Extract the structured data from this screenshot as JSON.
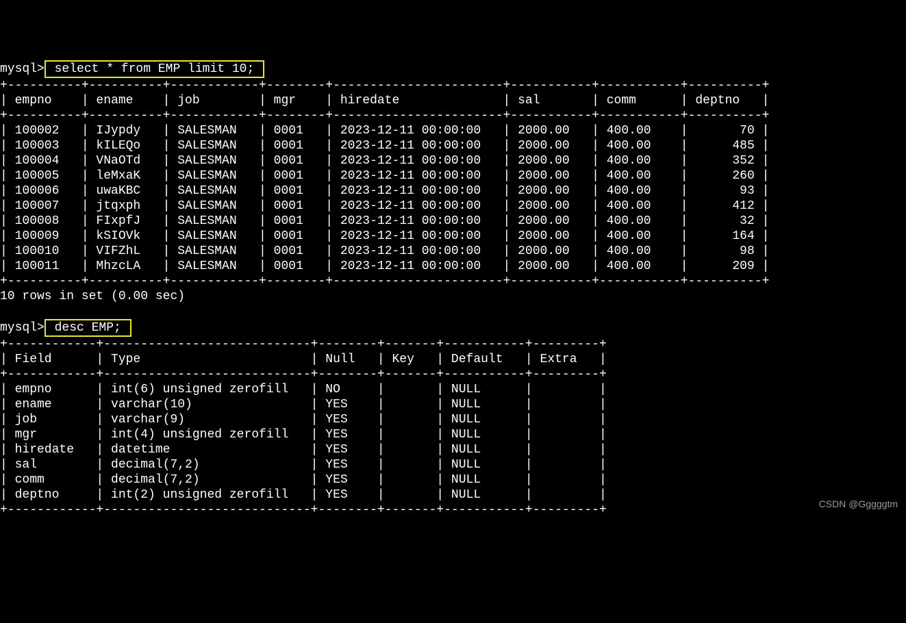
{
  "prompt": "mysql>",
  "query1": " select * from EMP limit 10; ",
  "query2": " desc EMP; ",
  "rows_msg": "10 rows in set (0.00 sec)",
  "watermark": "CSDN @Gggggtm",
  "chart_data": [
    {
      "type": "table",
      "title": "select * from EMP limit 10",
      "columns": [
        "empno",
        "ename",
        "job",
        "mgr",
        "hiredate",
        "sal",
        "comm",
        "deptno"
      ],
      "rows": [
        [
          "100002",
          "IJypdy",
          "SALESMAN",
          "0001",
          "2023-12-11 00:00:00",
          "2000.00",
          "400.00",
          "70"
        ],
        [
          "100003",
          "kILEQo",
          "SALESMAN",
          "0001",
          "2023-12-11 00:00:00",
          "2000.00",
          "400.00",
          "485"
        ],
        [
          "100004",
          "VNaOTd",
          "SALESMAN",
          "0001",
          "2023-12-11 00:00:00",
          "2000.00",
          "400.00",
          "352"
        ],
        [
          "100005",
          "leMxaK",
          "SALESMAN",
          "0001",
          "2023-12-11 00:00:00",
          "2000.00",
          "400.00",
          "260"
        ],
        [
          "100006",
          "uwaKBC",
          "SALESMAN",
          "0001",
          "2023-12-11 00:00:00",
          "2000.00",
          "400.00",
          "93"
        ],
        [
          "100007",
          "jtqxph",
          "SALESMAN",
          "0001",
          "2023-12-11 00:00:00",
          "2000.00",
          "400.00",
          "412"
        ],
        [
          "100008",
          "FIxpfJ",
          "SALESMAN",
          "0001",
          "2023-12-11 00:00:00",
          "2000.00",
          "400.00",
          "32"
        ],
        [
          "100009",
          "kSIOVk",
          "SALESMAN",
          "0001",
          "2023-12-11 00:00:00",
          "2000.00",
          "400.00",
          "164"
        ],
        [
          "100010",
          "VIFZhL",
          "SALESMAN",
          "0001",
          "2023-12-11 00:00:00",
          "2000.00",
          "400.00",
          "98"
        ],
        [
          "100011",
          "MhzcLA",
          "SALESMAN",
          "0001",
          "2023-12-11 00:00:00",
          "2000.00",
          "400.00",
          "209"
        ]
      ],
      "widths": [
        8,
        8,
        10,
        6,
        21,
        9,
        9,
        8
      ],
      "align": [
        "left",
        "left",
        "left",
        "left",
        "left",
        "left",
        "left",
        "right"
      ]
    },
    {
      "type": "table",
      "title": "desc EMP",
      "columns": [
        "Field",
        "Type",
        "Null",
        "Key",
        "Default",
        "Extra"
      ],
      "rows": [
        [
          "empno",
          "int(6) unsigned zerofill",
          "NO",
          "",
          "NULL",
          ""
        ],
        [
          "ename",
          "varchar(10)",
          "YES",
          "",
          "NULL",
          ""
        ],
        [
          "job",
          "varchar(9)",
          "YES",
          "",
          "NULL",
          ""
        ],
        [
          "mgr",
          "int(4) unsigned zerofill",
          "YES",
          "",
          "NULL",
          ""
        ],
        [
          "hiredate",
          "datetime",
          "YES",
          "",
          "NULL",
          ""
        ],
        [
          "sal",
          "decimal(7,2)",
          "YES",
          "",
          "NULL",
          ""
        ],
        [
          "comm",
          "decimal(7,2)",
          "YES",
          "",
          "NULL",
          ""
        ],
        [
          "deptno",
          "int(2) unsigned zerofill",
          "YES",
          "",
          "NULL",
          ""
        ]
      ],
      "widths": [
        10,
        26,
        6,
        5,
        9,
        7
      ],
      "align": [
        "left",
        "left",
        "left",
        "left",
        "left",
        "left"
      ]
    }
  ]
}
